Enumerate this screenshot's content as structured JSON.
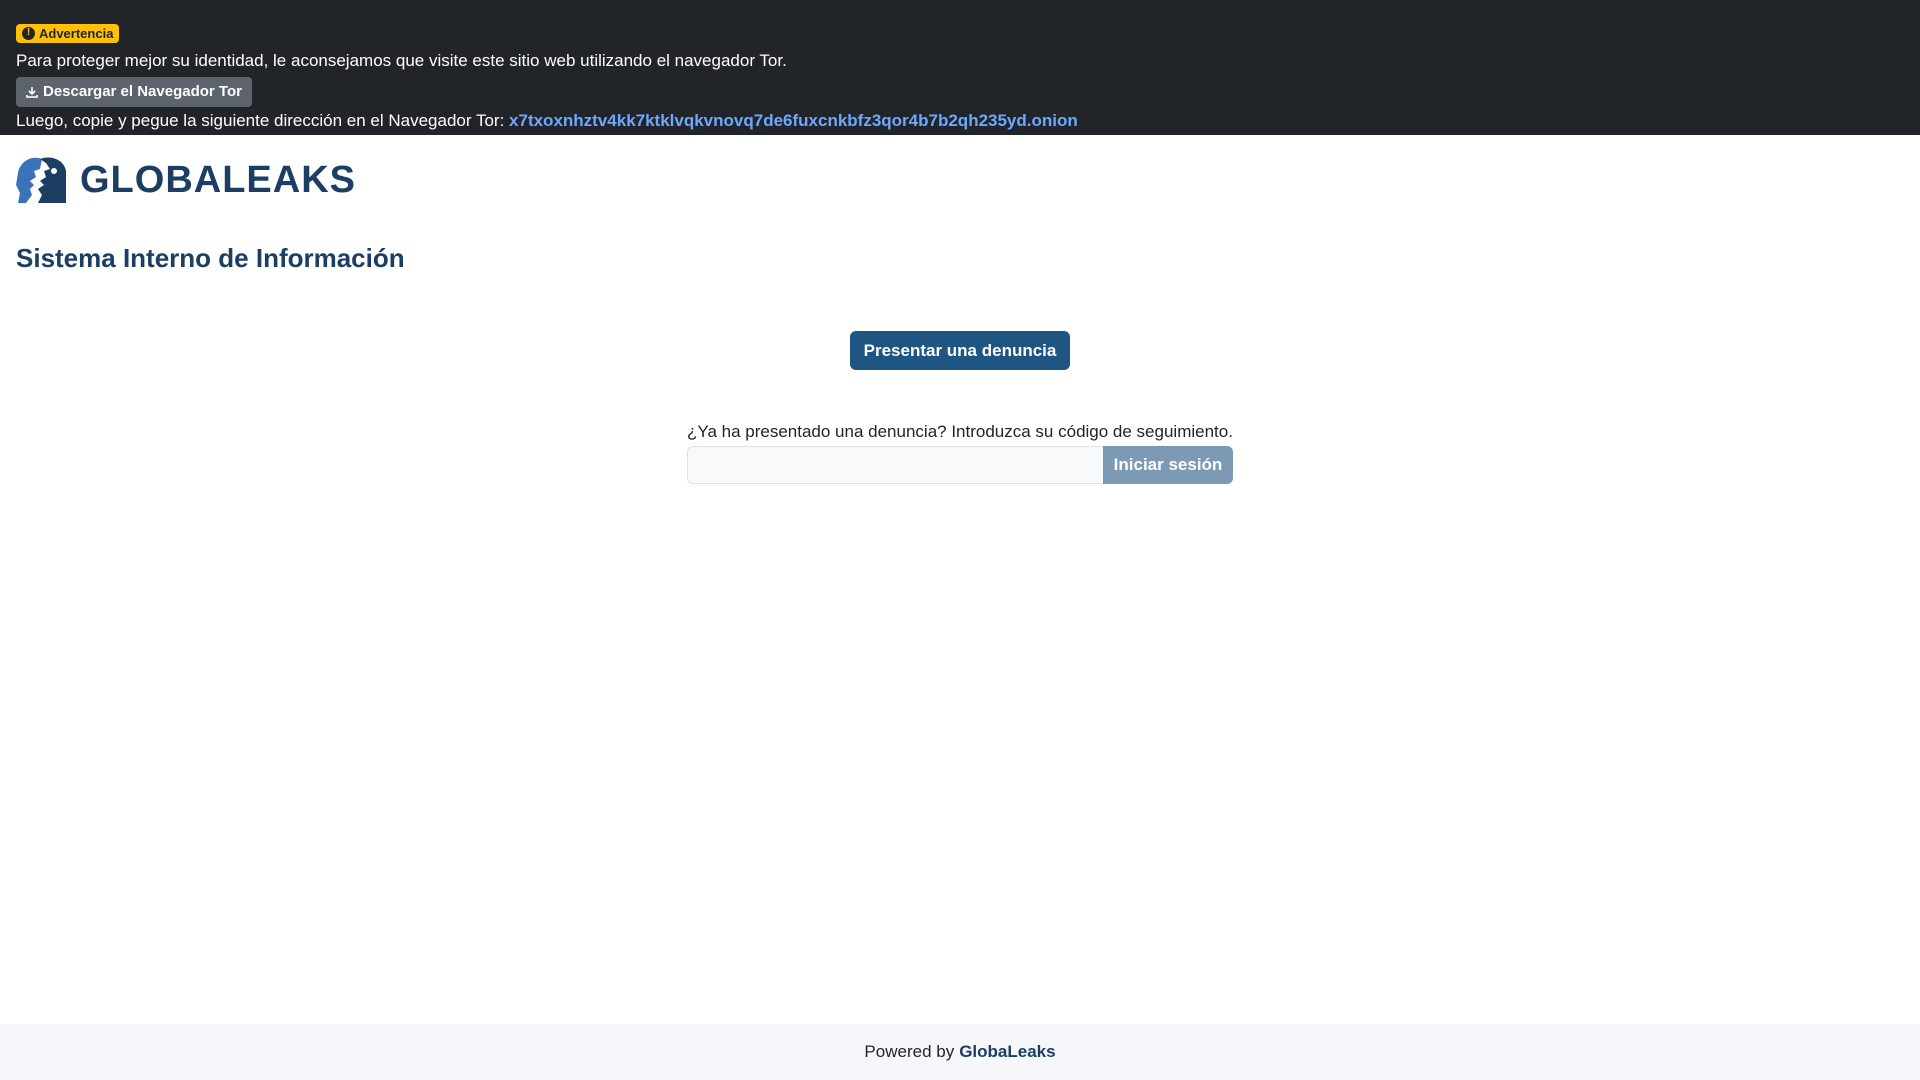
{
  "banner": {
    "badge_label": "Advertencia",
    "message": "Para proteger mejor su identidad, le aconsejamos que visite este sitio web utilizando el navegador Tor.",
    "download_label": "Descargar el Navegador Tor",
    "copy_instruction": "Luego, copie y pegue la siguiente dirección en el Navegador Tor:",
    "onion_address": "x7txoxnhztv4kk7ktklvqkvnovq7de6fuxcnkbfz3qor4b7b2qh235yd.onion"
  },
  "header": {
    "logo_text": "GLOBALEAKS"
  },
  "main": {
    "page_title": "Sistema Interno de Información",
    "submit_label": "Presentar una denuncia",
    "receipt_prompt": "¿Ya ha presentado una denuncia? Introduzca su código de seguimiento.",
    "receipt_value": "",
    "login_label": "Iniciar sesión"
  },
  "footer": {
    "powered_by": "Powered by",
    "brand": "GlobaLeaks"
  },
  "colors": {
    "banner_bg": "#212529",
    "warning": "#ffc107",
    "primary": "#1f5583",
    "brand_dark": "#1c3e63",
    "logo_accent": "#3b73b9",
    "link": "#6ea8fe"
  },
  "icons": {
    "badge": "exclamation-circle-icon",
    "download": "download-icon",
    "logo": "globaleaks-logo"
  }
}
